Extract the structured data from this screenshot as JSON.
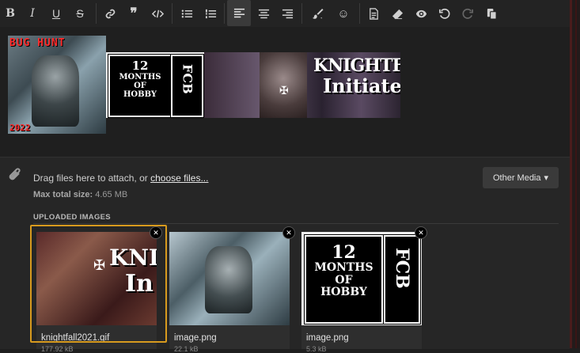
{
  "toolbar": {
    "bold": "B",
    "italic": "I",
    "underline": "U",
    "strike": "S",
    "quote": "❞",
    "emoji": "☺"
  },
  "signature": {
    "bughunt_title": "BUG HUNT",
    "bughunt_year": "2022",
    "months_line1": "12",
    "months_line2": "MONTHS",
    "months_line3": "OF",
    "months_line4": "HOBBY",
    "fcb": "FCB",
    "knight_title": "KNIGHTFALL",
    "knight_sub": "Initiate"
  },
  "attachments": {
    "drag_text": "Drag files here to attach, or",
    "choose_link": "choose files...",
    "max_label": "Max total size:",
    "max_value": "4.65 MB",
    "other_media": "Other Media",
    "uploaded_label": "UPLOADED IMAGES",
    "items": [
      {
        "name": "knightfall2021.gif",
        "size": "177.92 kB",
        "image_text_1": "KNIG",
        "image_text_2": "In"
      },
      {
        "name": "image.png",
        "size": "22.1 kB"
      },
      {
        "name": "image.png",
        "size": "5.3 kB",
        "line1": "12",
        "line2": "MONTHS",
        "line3": "OF",
        "line4": "HOBBY",
        "fcb": "FCB"
      }
    ]
  }
}
